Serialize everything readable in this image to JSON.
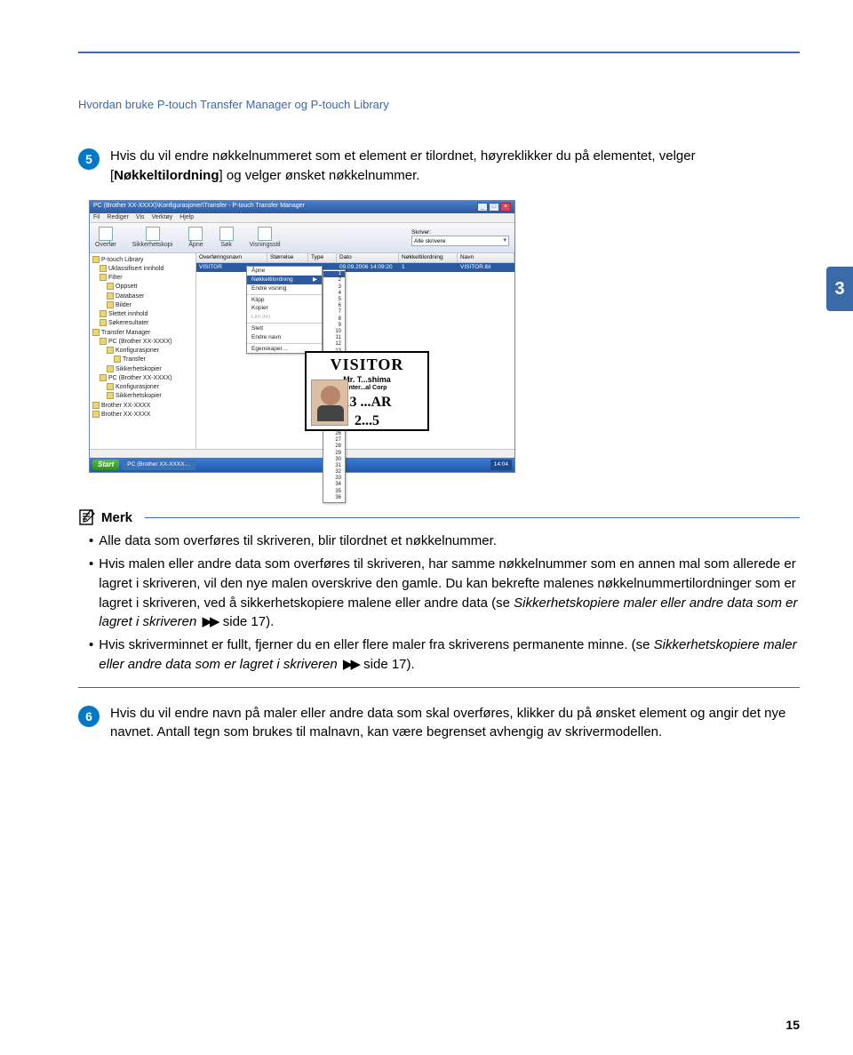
{
  "header": "Hvordan bruke P-touch Transfer Manager og P-touch Library",
  "chapter_tab": "3",
  "step5": {
    "num": "5",
    "p1a": "Hvis du vil endre nøkkelnummeret som et element er tilordnet, høyreklikker du på elementet, velger [",
    "p1b": "Nøkkeltilordning",
    "p1c": "] og velger ønsket nøkkelnummer."
  },
  "app": {
    "title": "PC (Brother XX-XXXX)\\Konfigurasjoner\\Transfer - P-touch Transfer Manager",
    "menu": [
      "Fil",
      "Rediger",
      "Vis",
      "Verktøy",
      "Hjelp"
    ],
    "toolbar": {
      "overfør": "Overfør",
      "backup": "Sikkerhetskopi",
      "åpne": "Åpne",
      "søk": "Søk",
      "visning": "Visningsstil",
      "skriver_label": "Skriver:",
      "skriver_value": "Alle skrivere"
    },
    "tree": [
      {
        "lvl": 0,
        "txt": "P-touch Library"
      },
      {
        "lvl": 1,
        "txt": "Uklassifisert innhold"
      },
      {
        "lvl": 1,
        "txt": "Filter"
      },
      {
        "lvl": 2,
        "txt": "Oppsett"
      },
      {
        "lvl": 2,
        "txt": "Databaser"
      },
      {
        "lvl": 2,
        "txt": "Bilder"
      },
      {
        "lvl": 1,
        "txt": "Slettet innhold"
      },
      {
        "lvl": 1,
        "txt": "Søkeresultater"
      },
      {
        "lvl": 0,
        "txt": "Transfer Manager"
      },
      {
        "lvl": 1,
        "txt": "PC (Brother XX-XXXX)"
      },
      {
        "lvl": 2,
        "txt": "Konfigurasjoner"
      },
      {
        "lvl": 3,
        "txt": "Transfer"
      },
      {
        "lvl": 2,
        "txt": "Sikkerhetskopier"
      },
      {
        "lvl": 1,
        "txt": "PC (Brother XX-XXXX)"
      },
      {
        "lvl": 2,
        "txt": "Konfigurasjoner"
      },
      {
        "lvl": 2,
        "txt": "Sikkerhetskopier"
      },
      {
        "lvl": 0,
        "txt": "Brother XX-XXXX"
      },
      {
        "lvl": 0,
        "txt": "Brother XX-XXXX"
      }
    ],
    "list_headers": [
      "Overføringsnavn",
      "Størrelse",
      "Type",
      "Dato",
      "Nøkkeltilordning",
      "Navn"
    ],
    "row": {
      "name": "VISITOR",
      "size": "",
      "type": "",
      "date": "09.09.2006 14:09:20",
      "key": "1",
      "file": "VISITOR.lbl"
    },
    "ctx": {
      "open": "Åpne",
      "key": "Nøkkeltilordning",
      "endre": "Endre visning",
      "cut": "Klipp",
      "copy": "Kopier",
      "paste": "Lim inn",
      "del": "Slett",
      "rename": "Endre navn",
      "props": "Egenskaper…"
    },
    "preview": {
      "title": "VISITOR",
      "name": "Mr. T...shima",
      "corp": "Inter...al Corp",
      "date1": "13 ...AR",
      "date2": "2...5"
    },
    "taskbar": {
      "start": "Start",
      "task": "PC (Brother XX-XXXX…",
      "clock": "14:04"
    }
  },
  "note": {
    "title": "Merk",
    "b1": "Alle data som overføres til skriveren, blir tilordnet et nøkkelnummer.",
    "b2a": "Hvis malen eller andre data som overføres til skriveren, har samme nøkkelnummer som en annen mal som allerede er lagret i skriveren, vil den nye malen overskrive den gamle. Du kan bekrefte malenes nøkkelnummertilordninger som er lagret i skriveren, ved å sikkerhetskopiere malene eller andre data (se ",
    "b2b": "Sikkerhetskopiere maler eller andre data som er lagret i skriveren",
    "b2c": " side 17).",
    "b3a": "Hvis skriverminnet er fullt, fjerner du en eller flere maler fra skriverens permanente minne. (se ",
    "b3b": "Sikkerhetskopiere maler eller andre data som er lagret i skriveren",
    "b3c": " side 17)."
  },
  "step6": {
    "num": "6",
    "text": "Hvis du vil endre navn på maler eller andre data som skal overføres, klikker du på ønsket element og angir det nye navnet. Antall tegn som brukes til malnavn, kan være begrenset avhengig av skrivermodellen."
  },
  "xref_arrows": "▶▶",
  "page_num": "15"
}
